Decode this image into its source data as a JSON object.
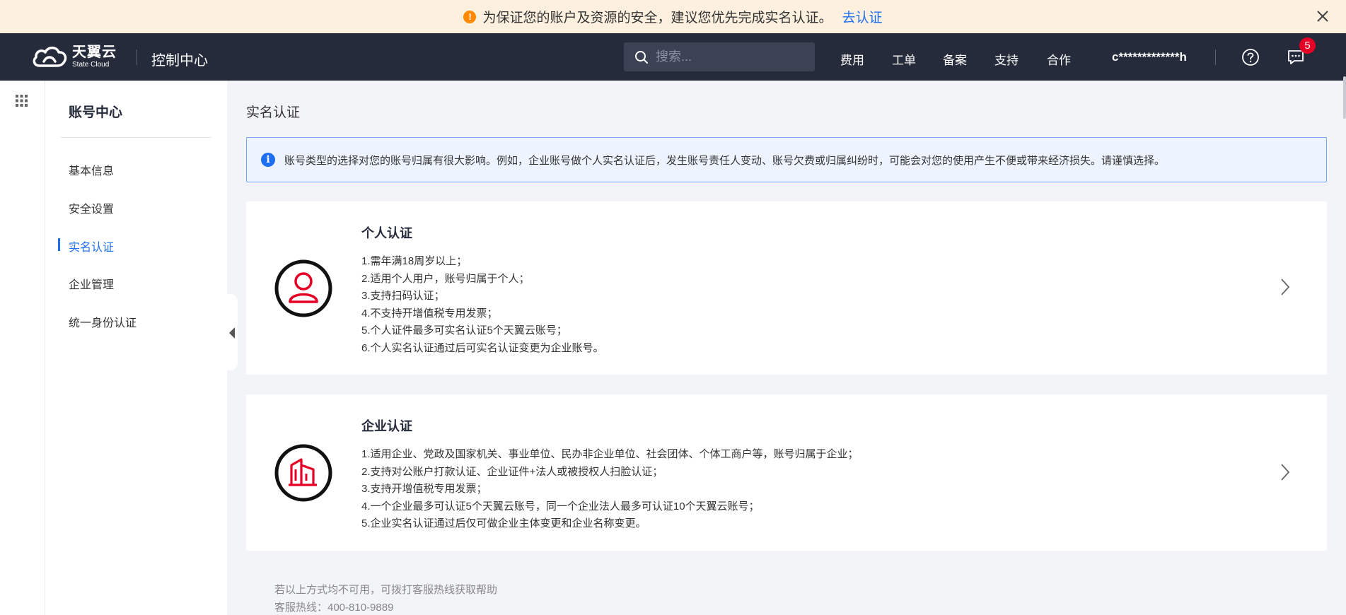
{
  "notice": {
    "icon": "warning-icon",
    "text": "为保证您的账户及资源的安全，建议您优先完成实名认证。",
    "link": "去认证",
    "close_icon": "close-icon"
  },
  "topnav": {
    "logo_cn": "天翼云",
    "logo_en": "State Cloud",
    "console_title": "控制中心",
    "search_placeholder": "搜索...",
    "links": [
      "费用",
      "工单",
      "备案",
      "支持",
      "合作"
    ],
    "user": "c*************h",
    "help_icon": "help-icon",
    "message_icon": "message-icon",
    "message_count": "5"
  },
  "sidebar": {
    "title": "账号中心",
    "items": [
      {
        "label": "基本信息",
        "active": false
      },
      {
        "label": "安全设置",
        "active": false
      },
      {
        "label": "实名认证",
        "active": true
      },
      {
        "label": "企业管理",
        "active": false
      },
      {
        "label": "统一身份认证",
        "active": false
      }
    ]
  },
  "main": {
    "page_title": "实名认证",
    "info_text": "账号类型的选择对您的账号归属有很大影响。例如，企业账号做个人实名认证后，发生账号责任人变动、账号欠费或归属纠纷时，可能会对您的使用产生不便或带来经济损失。请谨慎选择。",
    "cards": [
      {
        "title": "个人认证",
        "icon": "person-icon",
        "lines": [
          "1.需年满18周岁以上；",
          "2.适用个人用户，账号归属于个人；",
          "3.支持扫码认证；",
          "4.不支持开增值税专用发票；",
          "5.个人证件最多可实名认证5个天翼云账号；",
          "6.个人实名认证通过后可实名认证变更为企业账号。"
        ]
      },
      {
        "title": "企业认证",
        "icon": "building-icon",
        "lines": [
          "1.适用企业、党政及国家机关、事业单位、民办非企业单位、社会团体、个体工商户等，账号归属于企业；",
          "2.支持对公账户打款认证、企业证件+法人或被授权人扫脸认证；",
          "3.支持开增值税专用发票；",
          "4.一个企业最多可认证5个天翼云账号，同一个企业法人最多可认证10个天翼云账号；",
          "5.企业实名认证通过后仅可做企业主体变更和企业名称变更。"
        ]
      }
    ],
    "footer_help": "若以上方式均不可用，可拨打客服热线获取帮助",
    "footer_hotline": "客服热线：400-810-9889"
  },
  "colors": {
    "accent": "#1e6ff1",
    "nav_bg": "#252b3a",
    "brand_red": "#e60026",
    "notice_bg": "#fdf0df"
  }
}
